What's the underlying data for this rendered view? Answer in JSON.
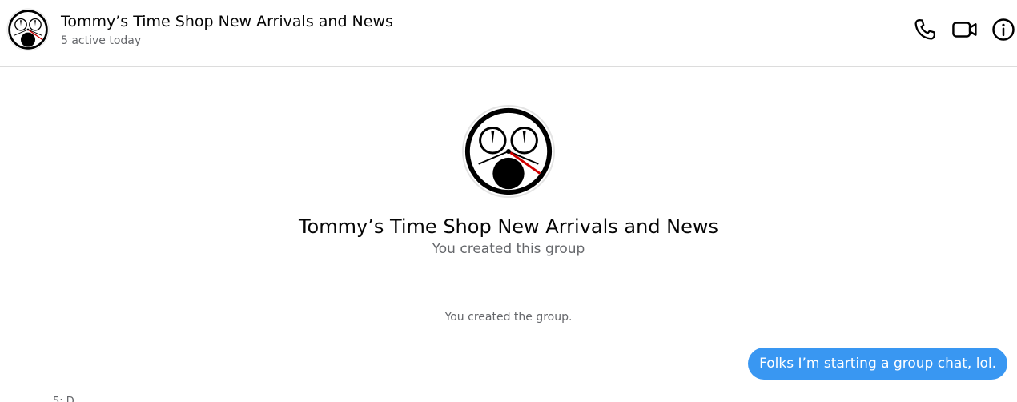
{
  "header": {
    "title": "Tommy’s Time Shop New Arrivals and News",
    "subtitle": "5 active today",
    "avatar_icon": "clock-face-logo-icon",
    "actions": [
      {
        "icon": "phone-icon",
        "label": ""
      },
      {
        "icon": "video-camera-icon",
        "label": ""
      },
      {
        "icon": "info-icon",
        "label": ""
      }
    ]
  },
  "intro": {
    "title": "Tommy’s Time Shop New Arrivals and News",
    "subtitle": "You created this group",
    "avatar_icon": "clock-face-logo-icon"
  },
  "messages": {
    "system": "You created the group.",
    "outgoing": [
      {
        "text": "Folks I’m starting a group chat, lol."
      }
    ],
    "cutoff_text": "5: D..."
  },
  "colors": {
    "bubble": "#3997f2",
    "muted_text": "#65676b",
    "divider": "#dcdcdc"
  }
}
